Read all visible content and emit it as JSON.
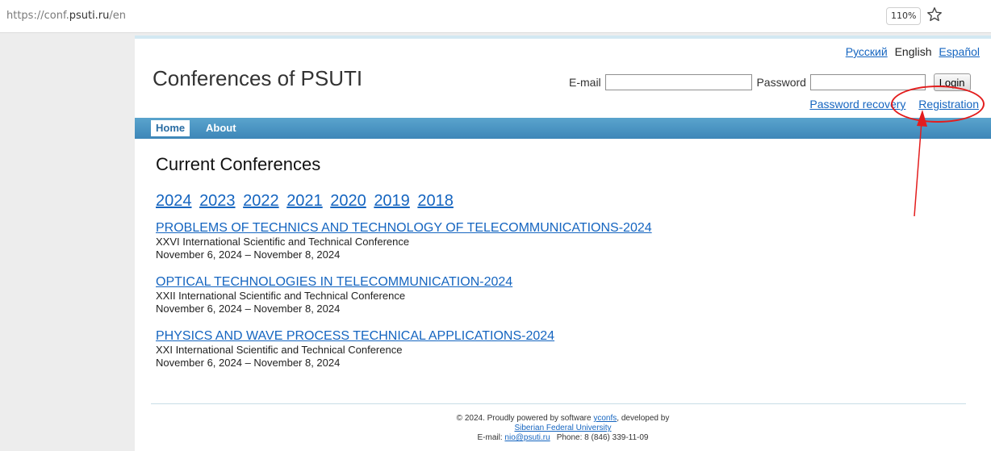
{
  "browser": {
    "url_prefix": "https://conf.",
    "url_domain": "psuti.ru",
    "url_suffix": "/en",
    "zoom": "110%"
  },
  "site": {
    "title": "Conferences of PSUTI"
  },
  "languages": {
    "russian": "Русский",
    "english": "English",
    "spanish": "Español"
  },
  "login": {
    "email_label": "E-mail",
    "email_value": "",
    "password_label": "Password",
    "password_value": "",
    "login_button": "Login",
    "password_recovery": "Password recovery",
    "registration": "Registration"
  },
  "nav": {
    "home": "Home",
    "about": "About"
  },
  "main": {
    "section_title": "Current Conferences",
    "years": [
      "2024",
      "2023",
      "2022",
      "2021",
      "2020",
      "2019",
      "2018"
    ],
    "conferences": [
      {
        "title": "PROBLEMS OF TECHNICS AND TECHNOLOGY OF TELECOMMUNICATIONS-2024",
        "subtitle": "XXVI International Scientific and Technical Conference",
        "dates": "November 6, 2024 – November 8, 2024"
      },
      {
        "title": "OPTICAL TECHNOLOGIES IN TELECOMMUNICATION-2024",
        "subtitle": "XXII International Scientific and Technical Conference",
        "dates": "November 6, 2024 – November 8, 2024"
      },
      {
        "title": "PHYSICS AND WAVE PROCESS TECHNICAL APPLICATIONS-2024",
        "subtitle": "XXI International Scientific and Technical Conference",
        "dates": "November 6, 2024 – November 8, 2024"
      }
    ]
  },
  "footer": {
    "powered_prefix": "© 2024. Proudly powered by software ",
    "software_link": "yconfs",
    "developed_by": ", developed by",
    "university_link": "Siberian Federal University",
    "email_prefix": "E-mail: ",
    "email_link": "nio@psuti.ru",
    "phone": "Phone: 8 (846) 339-11-09"
  },
  "colors": {
    "link": "#1565c0",
    "nav_bar": "#4a93c3",
    "annotation": "#e31d1d"
  }
}
